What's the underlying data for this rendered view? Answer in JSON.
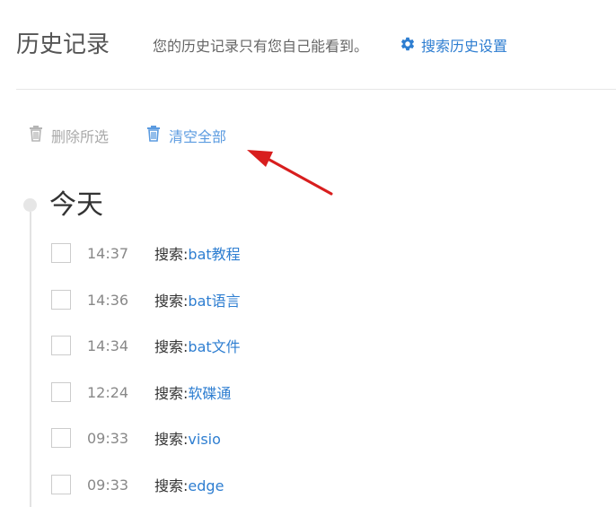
{
  "header": {
    "title": "历史记录",
    "privacy_note": "您的历史记录只有您自己能看到。",
    "settings_link": "搜索历史设置"
  },
  "actions": {
    "delete_selected": "删除所选",
    "clear_all": "清空全部"
  },
  "timeline": {
    "day_label": "今天",
    "items": [
      {
        "time": "14:37",
        "prefix": "搜索:",
        "keyword": "bat教程"
      },
      {
        "time": "14:36",
        "prefix": "搜索:",
        "keyword": "bat语言"
      },
      {
        "time": "14:34",
        "prefix": "搜索:",
        "keyword": "bat文件"
      },
      {
        "time": "12:24",
        "prefix": "搜索:",
        "keyword": "软碟通"
      },
      {
        "time": "09:33",
        "prefix": "搜索:",
        "keyword": "visio"
      },
      {
        "time": "09:33",
        "prefix": "搜索:",
        "keyword": "edge"
      }
    ]
  },
  "colors": {
    "link": "#2e7ed1",
    "annotation_arrow": "#d81e1e"
  },
  "icons": {
    "settings": "gear-icon",
    "delete_selected": "trash-icon",
    "clear_all": "trash-icon",
    "annotation": "red-arrow"
  }
}
